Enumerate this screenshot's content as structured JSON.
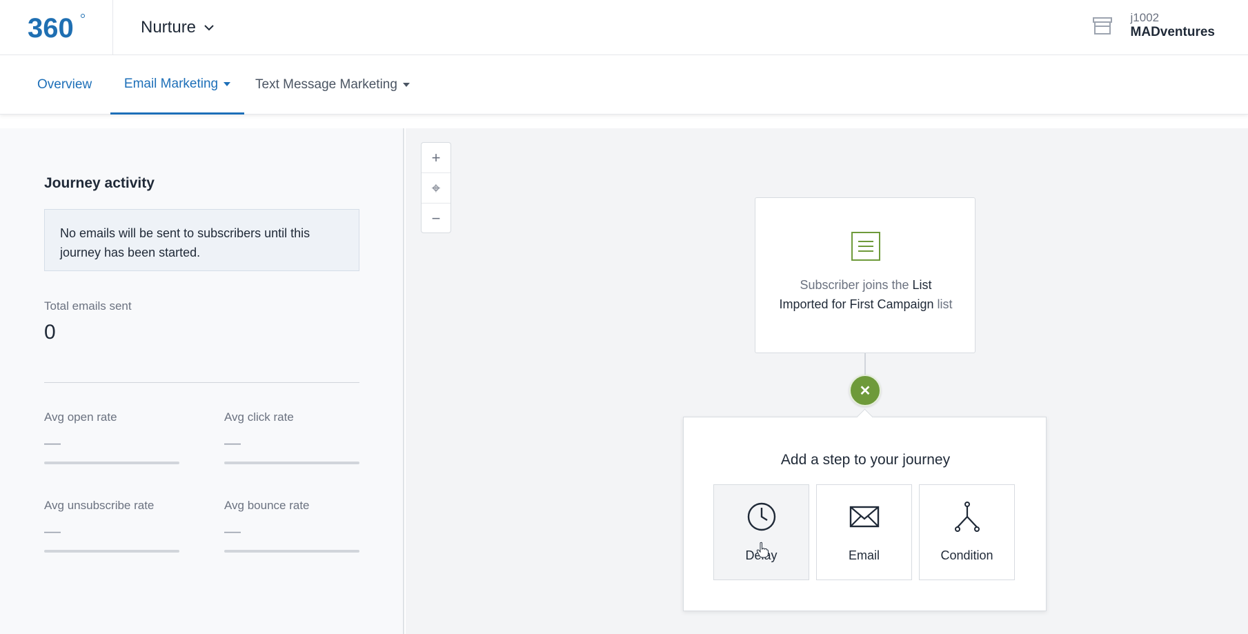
{
  "header": {
    "app_name": "Nurture",
    "account_id": "j1002",
    "account_name": "MADventures",
    "logo_text": "360"
  },
  "tabs": [
    {
      "label": "Overview"
    },
    {
      "label": "Email Marketing"
    },
    {
      "label": "Text Message Marketing"
    }
  ],
  "activity": {
    "title": "Journey activity",
    "notice": "No emails will be sent to subscribers until this journey has been started.",
    "total_label": "Total emails sent",
    "total_value": "0",
    "stats": {
      "open": {
        "label": "Avg open rate",
        "value": "—"
      },
      "click": {
        "label": "Avg click rate",
        "value": "—"
      },
      "unsub": {
        "label": "Avg unsubscribe rate",
        "value": "—"
      },
      "bounce": {
        "label": "Avg bounce rate",
        "value": "—"
      }
    }
  },
  "canvas": {
    "zoom": {
      "in": "+",
      "fit": "⌖",
      "out": "−"
    },
    "trigger": {
      "prefix": "Subscriber joins the",
      "list_name": "List Imported for First Campaign",
      "suffix": "list"
    },
    "close_symbol": "✕",
    "add_step": {
      "title": "Add a step to your journey",
      "options": [
        {
          "label": "Delay",
          "icon": "clock-icon"
        },
        {
          "label": "Email",
          "icon": "envelope-icon"
        },
        {
          "label": "Condition",
          "icon": "branch-icon"
        }
      ]
    }
  },
  "colors": {
    "accent_blue": "#1d6fb8",
    "green": "#6e9a3a",
    "logo_blue": "#1f6fb2"
  }
}
